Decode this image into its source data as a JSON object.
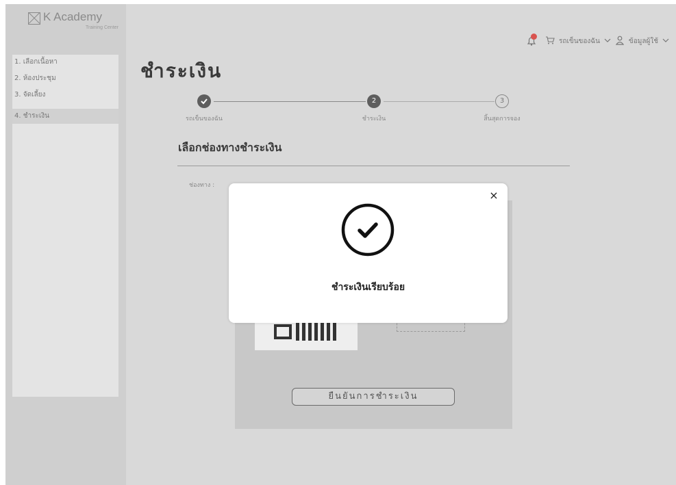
{
  "brand": {
    "name": "K Academy",
    "subtitle": "Training Center"
  },
  "sidebar": {
    "items": [
      {
        "label": "1. เลือกเนื้อหา"
      },
      {
        "label": "2. ห้องประชุม"
      },
      {
        "label": "3. จัดเลี้ยง"
      },
      {
        "label": "4. ชำระเงิน"
      }
    ]
  },
  "topbar": {
    "cart_label": "รถเข็นของฉัน",
    "user_label": "ข้อมูลผู้ใช้"
  },
  "page": {
    "title": "ชำระเงิน"
  },
  "stepper": {
    "steps": [
      {
        "number": "",
        "label": "รถเข็นของฉัน",
        "state": "done"
      },
      {
        "number": "2",
        "label": "ชำระเงิน",
        "state": "current"
      },
      {
        "number": "3",
        "label": "สิ้นสุดการจอง",
        "state": "future"
      }
    ]
  },
  "payment": {
    "section_title": "เลือกช่องทางชำระเงิน",
    "method_label": "ช่องทาง :"
  },
  "confirm_button": "ยืนยันการชำระเงิน",
  "modal": {
    "message": "ชำระเงินเรียบร้อย",
    "close_symbol": "×"
  },
  "colors": {
    "notification": "#d9534f",
    "step_active": "#5e5e5e"
  }
}
